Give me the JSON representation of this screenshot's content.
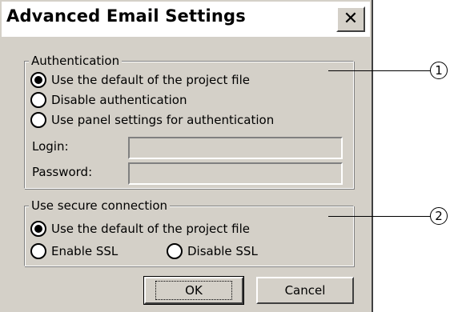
{
  "dialog": {
    "title": "Advanced Email Settings",
    "close_icon": "close-x-icon"
  },
  "authentication": {
    "legend": "Authentication",
    "options": [
      {
        "label": "Use the default of the project file",
        "checked": true
      },
      {
        "label": "Disable authentication",
        "checked": false
      },
      {
        "label": "Use panel settings for authentication",
        "checked": false
      }
    ],
    "login_label": "Login:",
    "login_value": "",
    "password_label": "Password:",
    "password_value": ""
  },
  "secure_connection": {
    "legend": "Use secure connection",
    "options": [
      {
        "label": "Use the default of the project file",
        "checked": true
      },
      {
        "label": "Enable SSL",
        "checked": false
      },
      {
        "label": "Disable SSL",
        "checked": false
      }
    ]
  },
  "buttons": {
    "ok": "OK",
    "cancel": "Cancel"
  },
  "callouts": [
    "1",
    "2"
  ]
}
